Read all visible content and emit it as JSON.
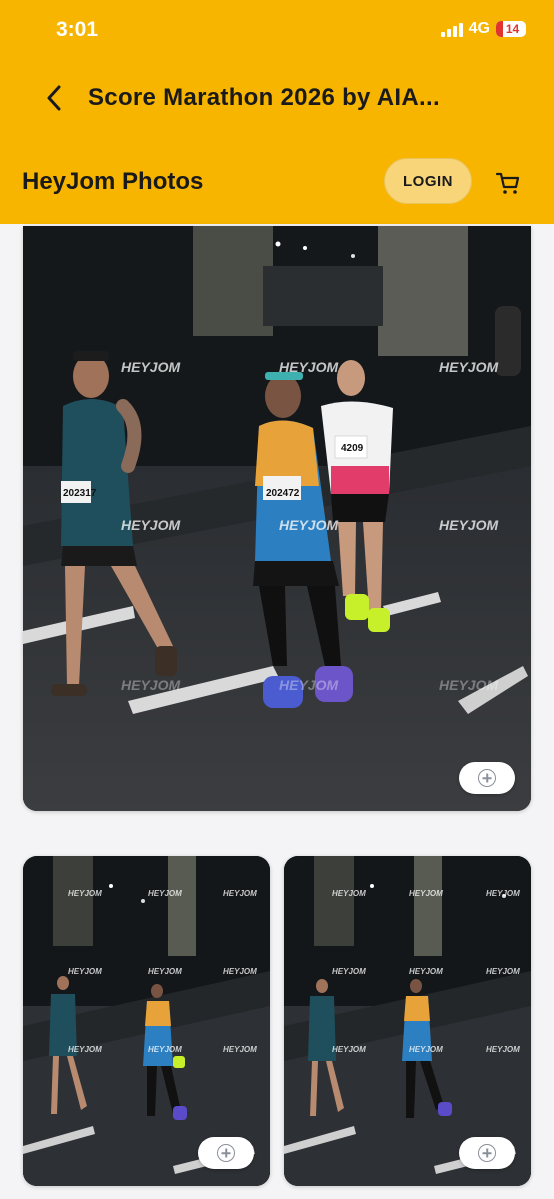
{
  "status_bar": {
    "time": "3:01",
    "network": "4G",
    "battery": "14"
  },
  "nav": {
    "title": "Score Marathon 2026 by AIA...",
    "back_icon": "chevron-left-icon"
  },
  "header": {
    "brand": "HeyJom Photos",
    "login_label": "LOGIN",
    "cart_icon": "cart-icon"
  },
  "photos": {
    "watermark": "HEYJOM",
    "featured": {
      "bibs": [
        "202317",
        "202472",
        "4209"
      ],
      "add_icon": "add-circle-icon"
    },
    "thumb_left": {
      "add_icon": "add-circle-icon"
    },
    "thumb_right": {
      "add_icon": "add-circle-icon"
    }
  },
  "colors": {
    "brand_yellow": "#f7b500",
    "login_bg": "#f9d57a",
    "page_bg": "#f4f4f6"
  }
}
